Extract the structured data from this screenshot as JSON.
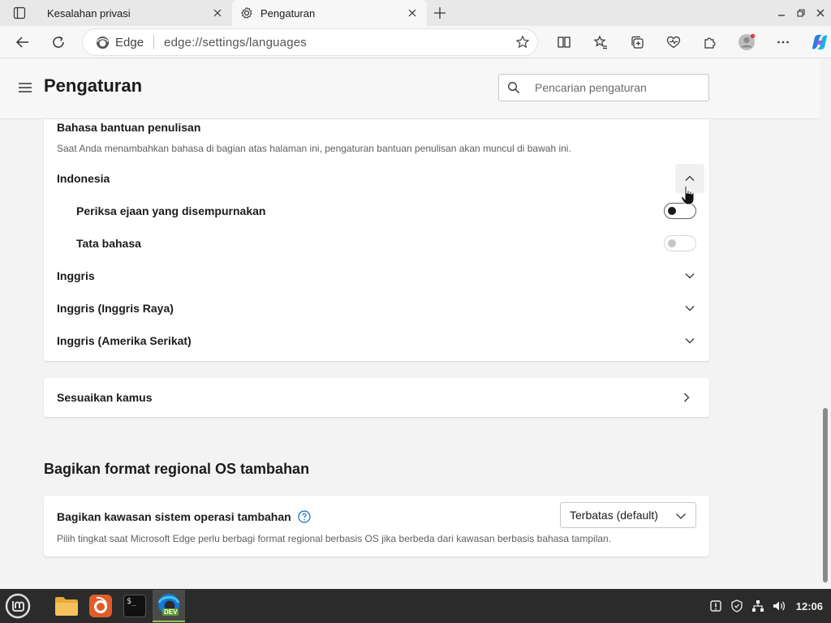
{
  "browser": {
    "tabs": [
      {
        "label": "Kesalahan privasi",
        "active": false
      },
      {
        "label": "Pengaturan",
        "active": true
      }
    ],
    "address": {
      "site_label": "Edge",
      "url": "edge://settings/languages"
    }
  },
  "settings": {
    "title": "Pengaturan",
    "search_placeholder": "Pencarian pengaturan",
    "writing_assist": {
      "heading": "Bahasa bantuan penulisan",
      "description": "Saat Anda menambahkan bahasa di bagian atas halaman ini, pengaturan bantuan penulisan akan muncul di bawah ini.",
      "languages": [
        {
          "name": "Indonesia",
          "expanded": true
        },
        {
          "name": "Inggris",
          "expanded": false
        },
        {
          "name": "Inggris (Inggris Raya)",
          "expanded": false
        },
        {
          "name": "Inggris (Amerika Serikat)",
          "expanded": false
        }
      ],
      "indonesia_options": [
        {
          "label": "Periksa ejaan yang disempurnakan",
          "on": false,
          "disabled": false
        },
        {
          "label": "Tata bahasa",
          "on": false,
          "disabled": true
        }
      ]
    },
    "customize_dictionary": "Sesuaikan kamus",
    "regional_format": {
      "heading": "Bagikan format regional OS tambahan",
      "label": "Bagikan kawasan sistem operasi tambahan",
      "description": "Pilih tingkat saat Microsoft Edge perlu berbagi format regional berbasis OS jika berbeda dari kawasan berbasis bahasa tampilan.",
      "selected_value": "Terbatas (default)"
    }
  },
  "taskbar": {
    "apps": [
      "mint-menu",
      "files",
      "firefox",
      "terminal",
      "edge-dev"
    ],
    "edge_badge": "DEV",
    "terminal_label": "$_",
    "clock": "12:06"
  },
  "colors": {
    "accent": "#0f6cbd",
    "help_icon": "#0f6cbd",
    "taskbar": "#2b2b2b"
  }
}
